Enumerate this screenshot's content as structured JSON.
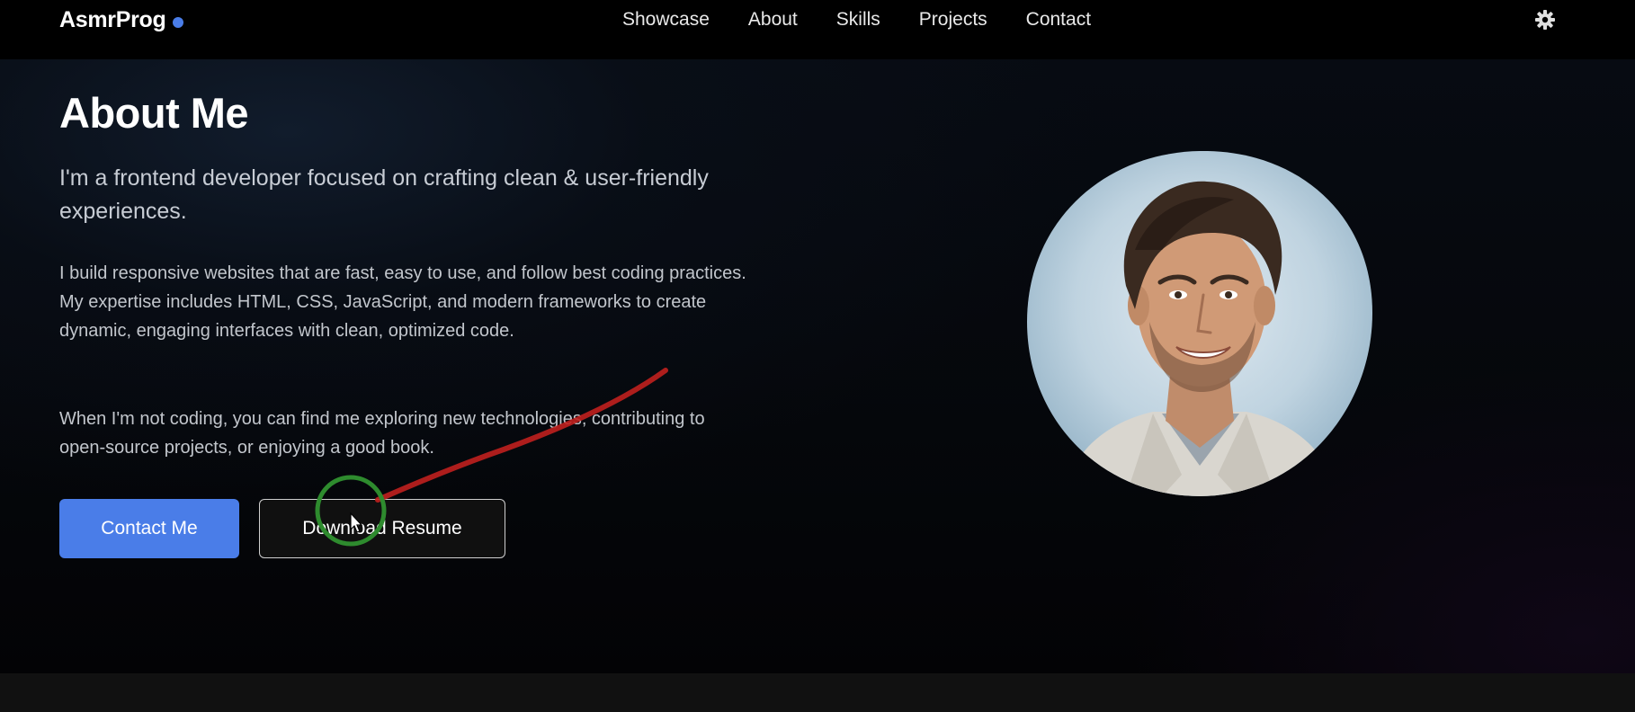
{
  "brand": {
    "name": "AsmrProg",
    "dot_color": "#4a7de8"
  },
  "nav": {
    "links": [
      "Showcase",
      "About",
      "Skills",
      "Projects",
      "Contact"
    ],
    "theme_icon": "gear-icon"
  },
  "about": {
    "title": "About Me",
    "subtitle": "I'm a frontend developer focused on crafting clean & user-friendly experiences.",
    "paragraphs": [
      "I build responsive websites that are fast, easy to use, and follow best coding practices. My expertise includes HTML, CSS, JavaScript, and modern frameworks to create dynamic, engaging interfaces with clean, optimized code.",
      "When I'm not coding, you can find me exploring new technologies, contributing to open-source projects, or enjoying a good book."
    ],
    "buttons": {
      "contact": "Contact Me",
      "resume": "Download Resume"
    },
    "photo_icon": "profile-photo"
  },
  "colors": {
    "accent": "#4a7de8",
    "background": "#000000",
    "annotation_arrow": "#c0201e",
    "annotation_circle": "#2e8b2e"
  }
}
